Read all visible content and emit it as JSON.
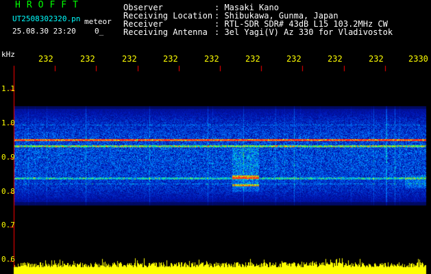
{
  "header": {
    "app_logo": "HROFFT",
    "filename": "UT2508302320.pn",
    "mode": "meteor",
    "datetime": "25.08.30 23:20",
    "status_mark": "0_"
  },
  "station_info": [
    {
      "label": "Observer",
      "value": ": Masaki Kano"
    },
    {
      "label": "Receiving Location",
      "value": ": Shibukawa, Gunma, Japan"
    },
    {
      "label": "Receiver",
      "value": ": RTL-SDR SDR# 43dB L15 103.2MHz CW"
    },
    {
      "label": "Receiving Antenna",
      "value": ": 3el Yagi(V) Az 330 for Vladivostok"
    }
  ],
  "axis": {
    "freq_unit": "kHz",
    "time_ticks": [
      "232",
      "232",
      "232",
      "232",
      "232",
      "232",
      "232",
      "232",
      "232",
      "2330"
    ],
    "freq_ticks": [
      "1.1",
      "1.0",
      "0.9",
      "0.8",
      "0.7",
      "0.6"
    ]
  },
  "colors": {
    "background": "#000000",
    "logo": "#00ff00",
    "filename": "#00ffff",
    "text": "#ffffff",
    "axis_labels": "#ffff00",
    "axis_ticks": "#ff0000",
    "noise_floor": "#ffff00"
  }
}
